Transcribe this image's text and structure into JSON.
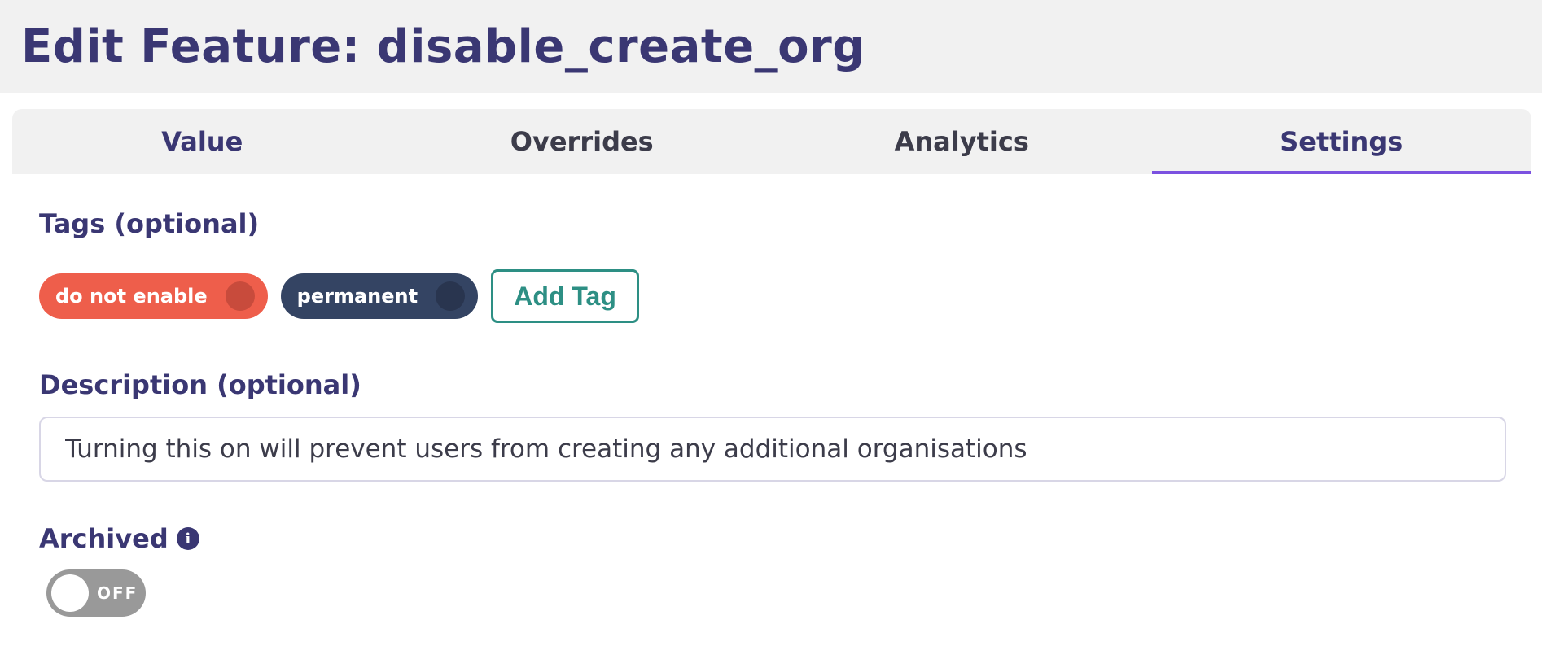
{
  "header": {
    "title": "Edit Feature: disable_create_org"
  },
  "tabs": [
    {
      "label": "Value",
      "active": false
    },
    {
      "label": "Overrides",
      "active": false
    },
    {
      "label": "Analytics",
      "active": false
    },
    {
      "label": "Settings",
      "active": true
    }
  ],
  "settings": {
    "tags_label": "Tags (optional)",
    "tags": [
      {
        "label": "do not enable",
        "color": "#ee5e4b"
      },
      {
        "label": "permanent",
        "color": "#344463"
      }
    ],
    "add_tag_label": "Add Tag",
    "description_label": "Description (optional)",
    "description_value": "Turning this on will prevent users from creating any additional organisations",
    "archived_label": "Archived",
    "archived_info_icon": "i",
    "archived_toggle_text": "OFF",
    "archived_on": false
  },
  "colors": {
    "accent": "#7b51e0",
    "primary_text": "#3a3773",
    "add_tag": "#2d8f84",
    "toggle_off": "#999999"
  }
}
